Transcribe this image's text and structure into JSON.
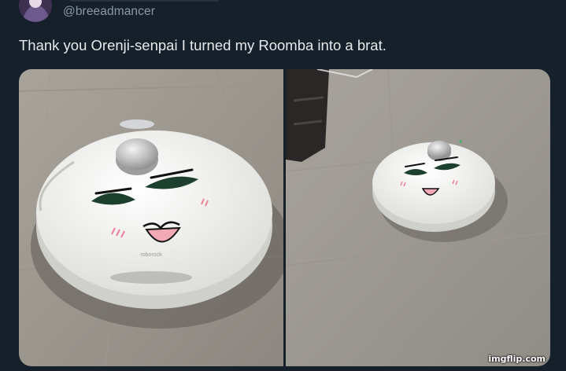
{
  "tweet": {
    "handle": "@breeadmancer",
    "text": "Thank you Orenji-senpai I turned my Roomba into a brat.",
    "photos": [
      {
        "icon": "roomba-photo-closeup",
        "brand_print": "roborock"
      },
      {
        "icon": "roomba-photo-wide"
      }
    ]
  },
  "watermark": "imgflip.com",
  "colors": {
    "background": "#15202b",
    "text": "#e7e9ea",
    "secondary_text": "#8b98a5"
  }
}
